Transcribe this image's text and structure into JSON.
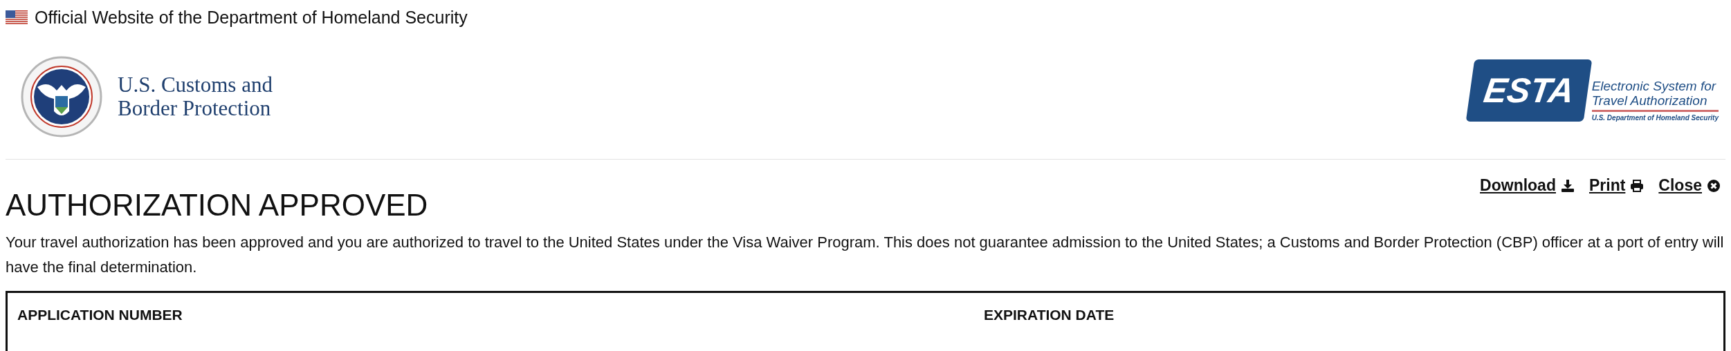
{
  "banner": {
    "text": "Official Website of the Department of Homeland Security"
  },
  "header": {
    "agency_logo": {
      "lines": [
        "U.S. Customs and",
        "Border Protection"
      ]
    },
    "esta_logo": {
      "mark": "ESTA",
      "lines": [
        "Electronic System for",
        "Travel Authorization"
      ],
      "tagline": "U.S. Department of Homeland Security"
    }
  },
  "actions": [
    {
      "kind": "download",
      "label": "Download"
    },
    {
      "kind": "print",
      "label": "Print"
    },
    {
      "kind": "close",
      "label": "Close"
    }
  ],
  "title": "AUTHORIZATION APPROVED",
  "message": "Your travel authorization has been approved and you are authorized to travel to the United States under the Visa Waiver Program. This does not guarantee admission to the United States; a Customs and Border Protection (CBP) officer at a port of entry will have the final determination.",
  "table": {
    "columns": [
      "APPLICATION NUMBER",
      "EXPIRATION DATE"
    ]
  }
}
